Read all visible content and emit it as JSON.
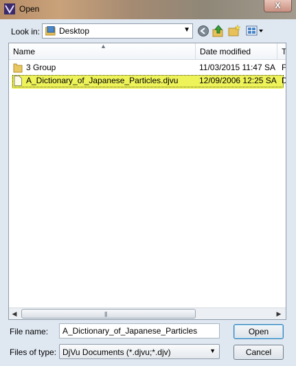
{
  "window": {
    "title": "Open",
    "close_label": "X"
  },
  "look_in": {
    "label": "Look in:",
    "value": "Desktop"
  },
  "columns": {
    "name": "Name",
    "date": "Date modified",
    "type": "Ty"
  },
  "files": [
    {
      "name": "3 Group",
      "date": "11/03/2015 11:47 SA",
      "type": "Fi",
      "icon": "folder-icon"
    },
    {
      "name": "A_Dictionary_of_Japanese_Particles.djvu",
      "date": "12/09/2006 12:25 SA",
      "type": "D.",
      "icon": "file-icon"
    }
  ],
  "file_name": {
    "label": "File name:",
    "value": "A_Dictionary_of_Japanese_Particles"
  },
  "files_of_type": {
    "label": "Files of type:",
    "value": "DjVu Documents (*.djvu;*.djv)"
  },
  "buttons": {
    "open": "Open",
    "cancel": "Cancel"
  },
  "colors": {
    "highlight": "#eef35a",
    "dialog_bg": "#dfe7f1"
  }
}
